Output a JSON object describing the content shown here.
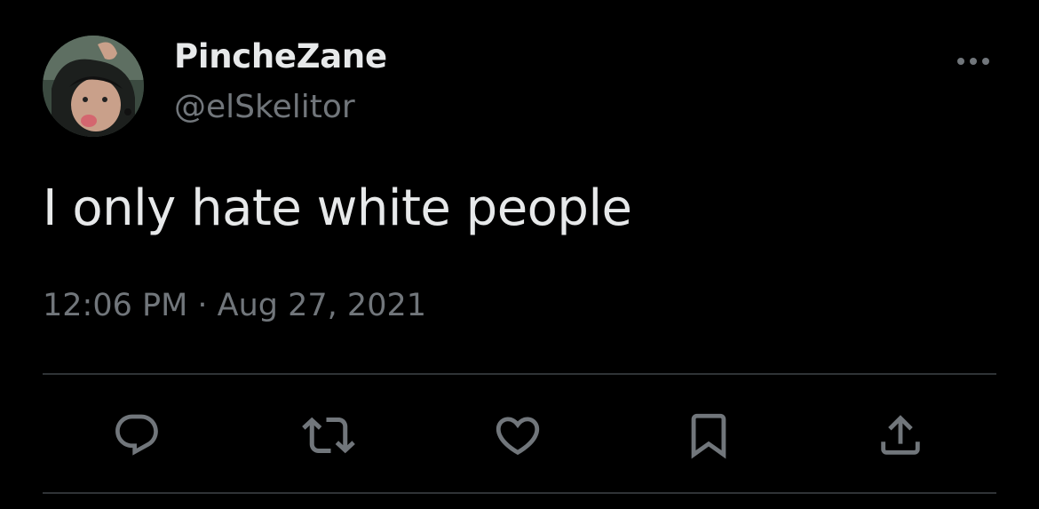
{
  "author": {
    "display_name": "PincheZane",
    "handle": "@elSkelitor"
  },
  "tweet": {
    "text": "I only hate white people",
    "timestamp": "12:06 PM · Aug 27, 2021"
  },
  "actions": {
    "reply_icon": "speech-bubble-icon",
    "retweet_icon": "retweet-arrows-icon",
    "like_icon": "heart-icon",
    "bookmark_icon": "bookmark-icon",
    "share_icon": "share-upload-icon"
  },
  "colors": {
    "background": "#000000",
    "primary_text": "#e7e9ea",
    "secondary_text": "#71767b",
    "divider": "#2f3336"
  }
}
